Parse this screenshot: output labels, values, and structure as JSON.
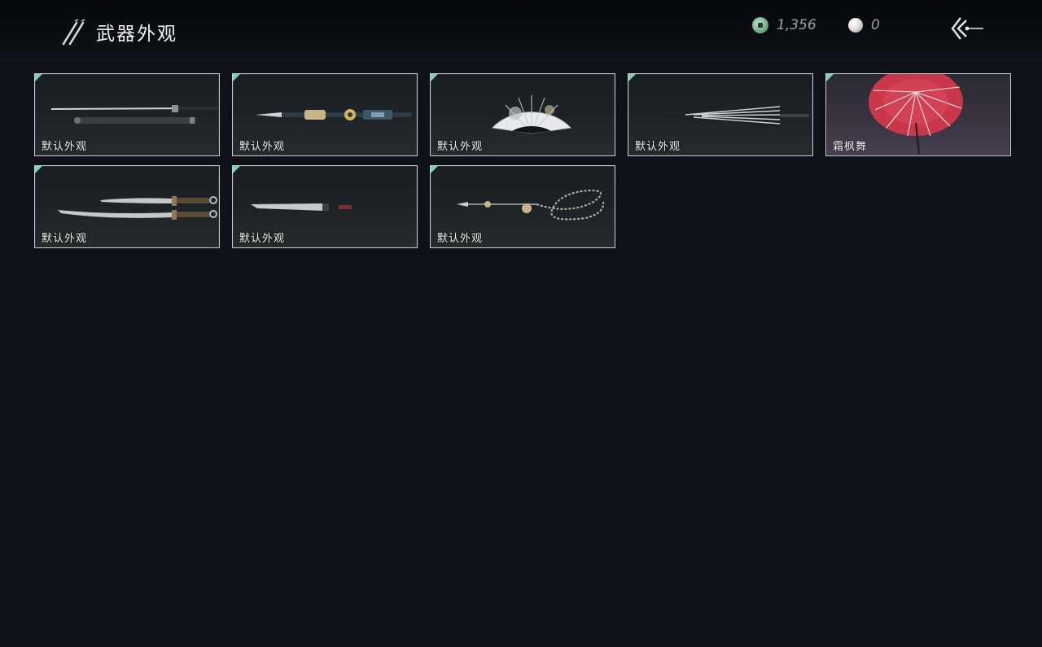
{
  "header": {
    "title": "武器外观",
    "title_icon": "crossed-blades-icon",
    "currencies": [
      {
        "icon": "jade-coin-icon",
        "value": "1,356"
      },
      {
        "icon": "pearl-icon",
        "value": "0"
      }
    ],
    "back_icon": "back-arrow-icon"
  },
  "colors": {
    "background": "#0e1218",
    "card_border": "#c9cdd2",
    "corner_accent": "#7fd1b2",
    "parasol_red": "#c8384a"
  },
  "weapons": [
    {
      "label": "默认外观",
      "art": "sword-and-scabbard-icon"
    },
    {
      "label": "默认外观",
      "art": "ornate-spear-icon"
    },
    {
      "label": "默认外观",
      "art": "folding-fan-icon"
    },
    {
      "label": "默认外观",
      "art": "closed-umbrella-icon"
    },
    {
      "label": "霜枫舞",
      "art": "red-parasol-icon"
    },
    {
      "label": "默认外观",
      "art": "dual-blades-icon"
    },
    {
      "label": "默认外观",
      "art": "long-glaive-icon"
    },
    {
      "label": "默认外观",
      "art": "rope-dart-icon"
    }
  ]
}
